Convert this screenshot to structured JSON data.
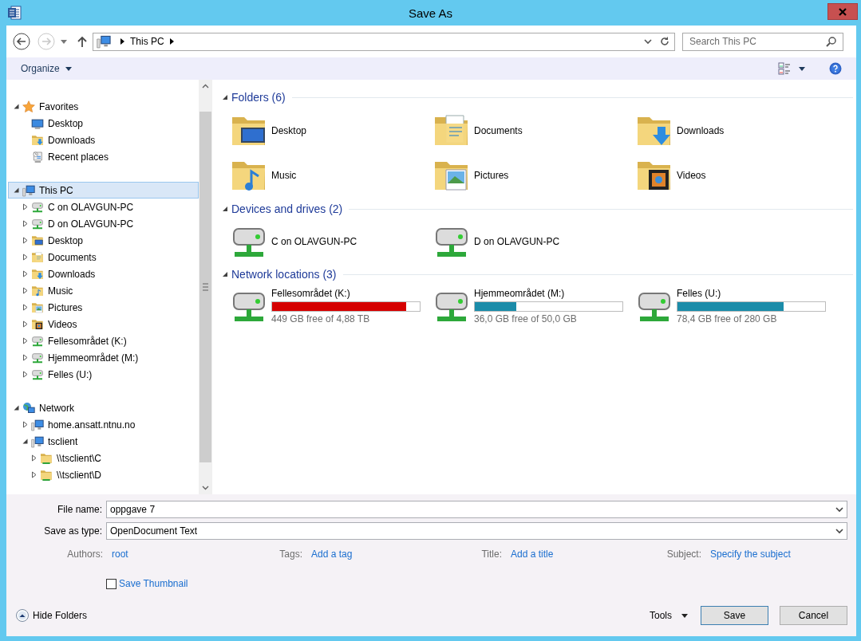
{
  "window": {
    "title": "Save As"
  },
  "nav": {
    "back": {
      "disabled": false
    },
    "forward": {
      "disabled": true
    }
  },
  "address": {
    "segments": [
      "This PC"
    ]
  },
  "search": {
    "placeholder": "Search This PC"
  },
  "toolbar": {
    "organize": "Organize"
  },
  "sidebar": {
    "tree": [
      {
        "label": "Favorites",
        "kind": "star",
        "expanded": true,
        "selected": false,
        "children": [
          {
            "label": "Desktop",
            "kind": "monitor",
            "selected": false
          },
          {
            "label": "Downloads",
            "kind": "folder-downloads",
            "selected": false
          },
          {
            "label": "Recent places",
            "kind": "recent",
            "selected": false
          }
        ]
      },
      {
        "label": "This PC",
        "kind": "computer",
        "expanded": true,
        "selected": true,
        "children": [
          {
            "label": "C on OLAVGUN-PC",
            "kind": "network-drive",
            "expanded": false,
            "selected": false
          },
          {
            "label": "D on OLAVGUN-PC",
            "kind": "network-drive",
            "expanded": false,
            "selected": false
          },
          {
            "label": "Desktop",
            "kind": "folder-desktop",
            "expanded": false,
            "selected": false
          },
          {
            "label": "Documents",
            "kind": "folder-documents",
            "expanded": false,
            "selected": false
          },
          {
            "label": "Downloads",
            "kind": "folder-downloads",
            "expanded": false,
            "selected": false
          },
          {
            "label": "Music",
            "kind": "folder-music",
            "expanded": false,
            "selected": false
          },
          {
            "label": "Pictures",
            "kind": "folder-pictures",
            "expanded": false,
            "selected": false
          },
          {
            "label": "Videos",
            "kind": "folder-videos",
            "expanded": false,
            "selected": false
          },
          {
            "label": "Fellesområdet (K:)",
            "kind": "network-drive",
            "expanded": false,
            "selected": false
          },
          {
            "label": "Hjemmeområdet (M:)",
            "kind": "network-drive",
            "expanded": false,
            "selected": false
          },
          {
            "label": "Felles (U:)",
            "kind": "network-drive",
            "expanded": false,
            "selected": false
          }
        ]
      },
      {
        "label": "Network",
        "kind": "network",
        "expanded": true,
        "selected": false,
        "children": [
          {
            "label": "home.ansatt.ntnu.no",
            "kind": "computer",
            "expanded": false,
            "selected": false
          },
          {
            "label": "tsclient",
            "kind": "computer",
            "expanded": true,
            "selected": false,
            "children": [
              {
                "label": "\\\\tsclient\\C",
                "kind": "folder-share",
                "expanded": false,
                "selected": false
              },
              {
                "label": "\\\\tsclient\\D",
                "kind": "folder-share",
                "expanded": false,
                "selected": false
              }
            ]
          }
        ]
      }
    ]
  },
  "sections": [
    {
      "title": "Folders (6)",
      "kind": "folders",
      "expanded": true,
      "items": [
        {
          "label": "Desktop",
          "kind": "folder-desktop"
        },
        {
          "label": "Documents",
          "kind": "folder-documents"
        },
        {
          "label": "Downloads",
          "kind": "folder-downloads"
        },
        {
          "label": "Music",
          "kind": "folder-music"
        },
        {
          "label": "Pictures",
          "kind": "folder-pictures"
        },
        {
          "label": "Videos",
          "kind": "folder-videos"
        }
      ]
    },
    {
      "title": "Devices and drives (2)",
      "kind": "drives",
      "expanded": true,
      "items": [
        {
          "label": "C on OLAVGUN-PC",
          "kind": "network-drive"
        },
        {
          "label": "D on OLAVGUN-PC",
          "kind": "network-drive"
        }
      ]
    },
    {
      "title": "Network locations (3)",
      "kind": "locations",
      "expanded": true,
      "items": [
        {
          "label": "Fellesområdet (K:)",
          "kind": "network-drive",
          "level": 0.91,
          "color": "#d50000",
          "reading": "449 GB free of 4,88 TB"
        },
        {
          "label": "Hjemmeområdet (M:)",
          "kind": "network-drive",
          "level": 0.28,
          "color": "#1b8ca9",
          "reading": "36,0 GB free of 50,0 GB"
        },
        {
          "label": "Felles (U:)",
          "kind": "network-drive",
          "level": 0.72,
          "color": "#1b8ca9",
          "reading": "78,4 GB free of 280 GB"
        }
      ]
    }
  ],
  "form": {
    "fields": [
      {
        "label": "File name:",
        "value": "oppgave 7"
      },
      {
        "label": "Save as type:",
        "value": "OpenDocument Text"
      }
    ],
    "metadata": [
      {
        "label": "Authors:",
        "value": "root"
      },
      {
        "label": "Tags:",
        "value": "Add a tag"
      },
      {
        "label": "Title:",
        "value": "Add a title"
      },
      {
        "label": "Subject:",
        "value": "Specify the subject"
      }
    ],
    "checkbox": {
      "label": "Save Thumbnail",
      "checked": false
    }
  },
  "footer": {
    "hide_folders": "Hide Folders",
    "tools": "Tools",
    "buttons": [
      {
        "label": "Save",
        "default": true
      },
      {
        "label": "Cancel",
        "default": false
      }
    ]
  }
}
